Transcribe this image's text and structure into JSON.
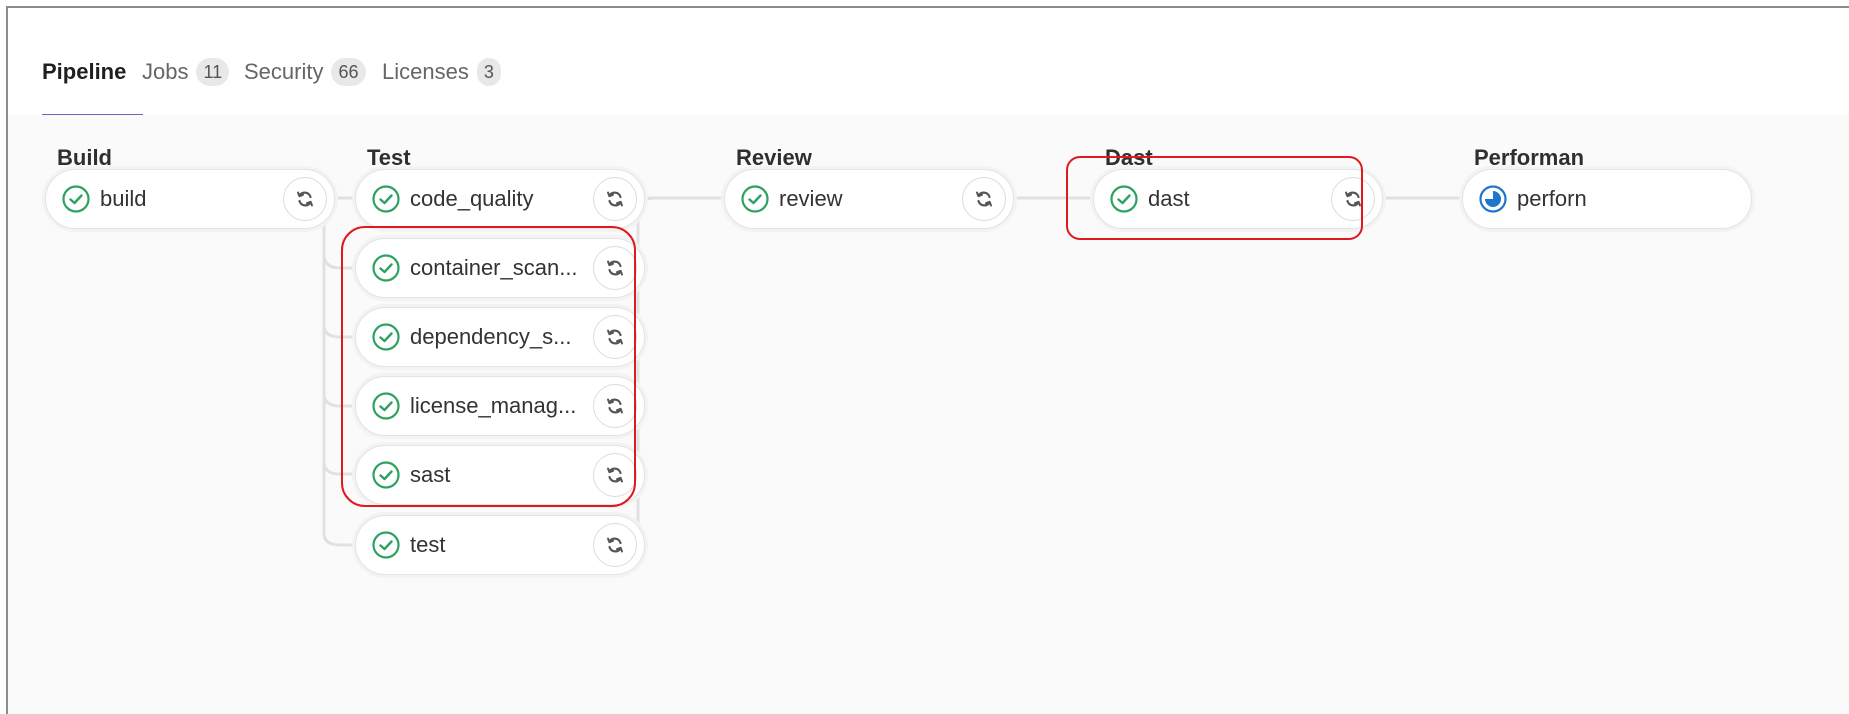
{
  "tabs": [
    {
      "label": "Pipeline",
      "count": null
    },
    {
      "label": "Jobs",
      "count": "11"
    },
    {
      "label": "Security",
      "count": "66"
    },
    {
      "label": "Licenses",
      "count": "3"
    }
  ],
  "stages": [
    {
      "title": "Build",
      "jobs": [
        {
          "name": "build",
          "status": "success"
        }
      ]
    },
    {
      "title": "Test",
      "jobs": [
        {
          "name": "code_quality",
          "status": "success"
        },
        {
          "name": "container_scan...",
          "status": "success"
        },
        {
          "name": "dependency_s...",
          "status": "success"
        },
        {
          "name": "license_manag...",
          "status": "success"
        },
        {
          "name": "sast",
          "status": "success"
        },
        {
          "name": "test",
          "status": "success"
        }
      ]
    },
    {
      "title": "Review",
      "jobs": [
        {
          "name": "review",
          "status": "success"
        }
      ]
    },
    {
      "title": "Dast",
      "jobs": [
        {
          "name": "dast",
          "status": "success"
        }
      ]
    },
    {
      "title": "Performan",
      "jobs": [
        {
          "name": "perforn",
          "status": "running"
        }
      ]
    }
  ],
  "colors": {
    "success": "#2da160",
    "running": "#1f75cb",
    "highlight": "#e0191f",
    "active_tab": "#6666c4"
  },
  "icons": {
    "success": "check-circle-icon",
    "running": "running-icon",
    "retry": "retry-icon"
  }
}
